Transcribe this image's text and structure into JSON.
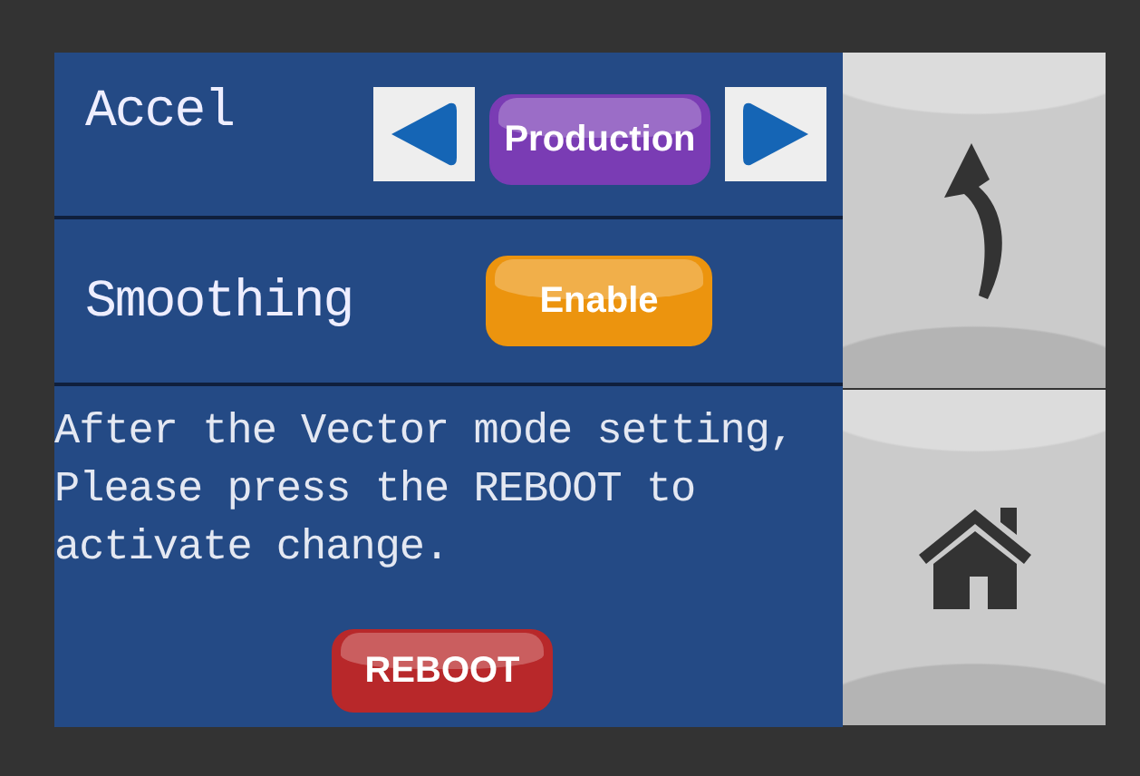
{
  "settings": [
    {
      "kind": "selector",
      "label": "Accel",
      "value": "Production",
      "color": "#7a3cb4"
    },
    {
      "kind": "toggle",
      "label": "Smoothing",
      "value": "Enable",
      "color": "#ec940e"
    }
  ],
  "notice": {
    "text": "After the Vector mode setting,\nPlease press the REBOOT to\nactivate change.",
    "button": "REBOOT",
    "color": "#b8282a"
  },
  "nav": [
    {
      "kind": "back"
    },
    {
      "kind": "home"
    }
  ]
}
